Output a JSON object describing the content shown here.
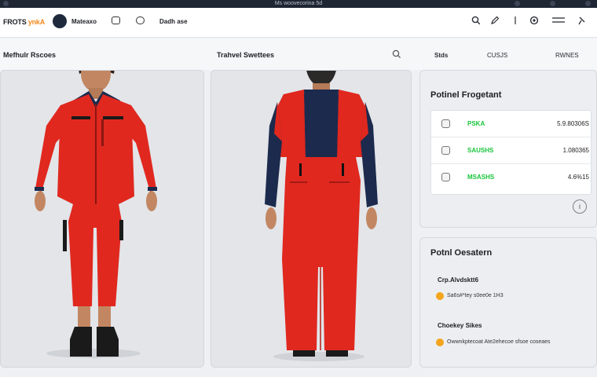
{
  "window": {
    "title": "Ms woovecorina 5d"
  },
  "topbar": {
    "brand_text": "FROTS",
    "brand_accent": "ynkA",
    "user_label": "Mateaxo",
    "nav_label": "Dadh ase"
  },
  "subbar": {
    "left_title": "Mefhulr Rscoes",
    "center_title": "Trahvel Swettees",
    "tabs": [
      "Stds",
      "CUSJS",
      "RWNES"
    ]
  },
  "product": {
    "front_view": {
      "label": "red work coverall front view",
      "main_color": "#e0281f",
      "accent_color": "#1c2a4d"
    },
    "back_view": {
      "label": "red work coverall back view",
      "main_color": "#e0281f",
      "accent_color": "#1c2a4d"
    }
  },
  "fragment_card": {
    "title": "Potinel Frogetant",
    "rows": [
      {
        "status": "PSKA",
        "value": "5.9.80306S"
      },
      {
        "status": "SAUSHS",
        "value": "1.080365"
      },
      {
        "status": "MSASHS",
        "value": "4.6%15"
      }
    ],
    "status_color": "#17c53a"
  },
  "operations_card": {
    "title": "Potnl Oesatern",
    "items": [
      {
        "heading": "Crp.Alvdsktt6",
        "text": "Sa6s#*tey s0ee0e 1H3"
      },
      {
        "heading": "Choekey Sikes",
        "text": "Owwnkptecoat Ate2ehecoe sfsoe coseaes"
      }
    ],
    "bullet_color": "#f4a51c"
  }
}
